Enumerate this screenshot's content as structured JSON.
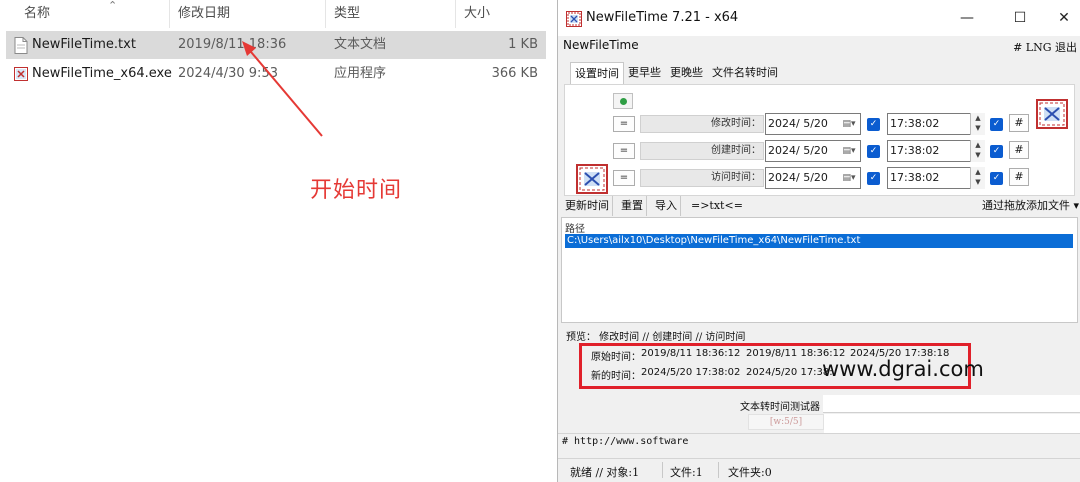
{
  "explorer": {
    "columns": {
      "name": "名称",
      "date": "修改日期",
      "type": "类型",
      "size": "大小"
    },
    "files": [
      {
        "name": "NewFileTime.txt",
        "date": "2019/8/11 18:36",
        "type": "文本文档",
        "size": "1 KB",
        "selected": true,
        "icon": "text-file-icon"
      },
      {
        "name": "NewFileTime_x64.exe",
        "date": "2024/4/30 9:53",
        "type": "应用程序",
        "size": "366 KB",
        "selected": false,
        "icon": "app-exe-icon"
      }
    ],
    "annotation": "开始时间",
    "annotation_color": "#e53935"
  },
  "app": {
    "title": "NewFileTime 7.21 - x64",
    "name": "NewFileTime",
    "menu_right": "#  LNG  退出",
    "window_buttons": {
      "minimize": "—",
      "maximize": "☐",
      "close": "✕"
    },
    "tabs": [
      "设置时间",
      "更早些",
      "更晚些",
      "文件名转时间"
    ],
    "rows": [
      {
        "eq": "=",
        "label": "修改时间：",
        "date": "2024/  5/20",
        "time": "17:38:02",
        "hash": "#"
      },
      {
        "eq": "=",
        "label": "创建时间：",
        "date": "2024/  5/20",
        "time": "17:38:02",
        "hash": "#"
      },
      {
        "eq": "=",
        "label": "访问时间：",
        "date": "2024/  5/20",
        "time": "17:38:02",
        "hash": "#"
      }
    ],
    "actions": [
      "更新时间",
      "重置",
      "导入",
      "=>txt<="
    ],
    "drop_menu": "通过拖放添加文件 ▾",
    "list": {
      "column": "路径",
      "path": "C:\\Users\\ailx10\\Desktop\\NewFileTime_x64\\NewFileTime.txt"
    },
    "preview": {
      "header": "预览：  修改时间    //   创建时间    //   访问时间",
      "original_label": "原始时间：",
      "original": [
        "2019/8/11 18:36:12",
        "2019/8/11 18:36:12",
        "2024/5/20 17:38:18"
      ],
      "new_label": "新的时间：",
      "new": [
        "2024/5/20 17:38:02",
        "2024/5/20 17:38:"
      ]
    },
    "watermark": "www.dgrai.com",
    "tester_label": "文本转时间测试器",
    "tester_deco": "[w:5/5]",
    "url": "# http://www.software",
    "status": {
      "ready": "就绪 // 对象:1",
      "files": "文件:1",
      "folders": "文件夹:0"
    },
    "accent_color": "#0b6dd6",
    "highlight_color": "#e0202a"
  }
}
